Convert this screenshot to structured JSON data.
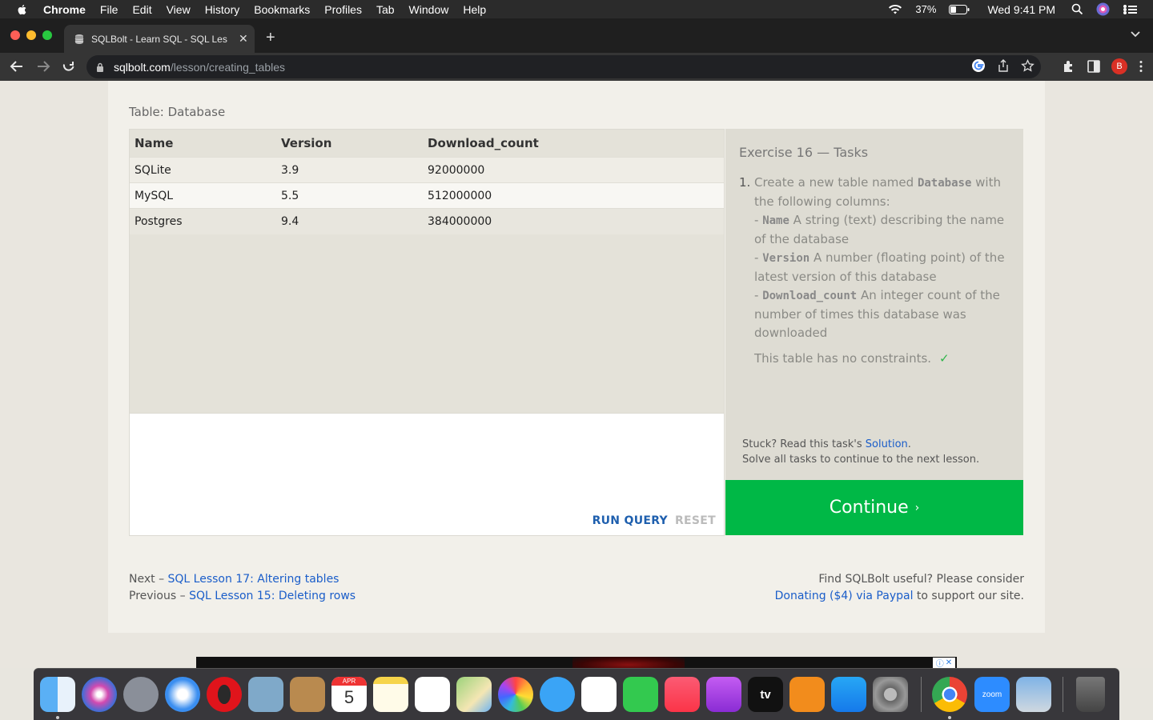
{
  "menubar": {
    "app_name": "Chrome",
    "items": [
      "File",
      "Edit",
      "View",
      "History",
      "Bookmarks",
      "Profiles",
      "Tab",
      "Window",
      "Help"
    ],
    "battery": "37%",
    "clock": "Wed 9:41 PM"
  },
  "browser": {
    "tab_title": "SQLBolt - Learn SQL - SQL Les",
    "url_host": "sqlbolt.com",
    "url_path": "/lesson/creating_tables",
    "profile_initial": "B"
  },
  "page": {
    "table_caption": "Table: Database",
    "columns": [
      "Name",
      "Version",
      "Download_count"
    ],
    "rows": [
      [
        "SQLite",
        "3.9",
        "92000000"
      ],
      [
        "MySQL",
        "5.5",
        "512000000"
      ],
      [
        "Postgres",
        "9.4",
        "384000000"
      ]
    ],
    "run_label": "RUN QUERY",
    "reset_label": "RESET",
    "tasks": {
      "heading": "Exercise 16 — Tasks",
      "number": "1.",
      "intro_a": "Create a new table named ",
      "intro_code": "Database",
      "intro_b": " with the following columns:",
      "cols": [
        {
          "code": "Name",
          "desc": " A string (text) describing the name of the database"
        },
        {
          "code": "Version",
          "desc": " A number (floating point) of the latest version of this database"
        },
        {
          "code": "Download_count",
          "desc": " An integer count of the number of times this database was downloaded"
        }
      ],
      "constraints": "This table has no constraints.",
      "check": "✓"
    },
    "stuck_a": "Stuck? Read this task's ",
    "stuck_link": "Solution",
    "stuck_b": ".",
    "solve_all": "Solve all tasks to continue to the next lesson.",
    "continue_label": "Continue",
    "continue_chevron": "›",
    "footer": {
      "next_label": "Next – ",
      "next_link": "SQL Lesson 17: Altering tables",
      "prev_label": "Previous – ",
      "prev_link": "SQL Lesson 15: Deleting rows",
      "consider": "Find SQLBolt useful? Please consider",
      "donate_link": "Donating ($4) via Paypal",
      "donate_tail": " to support our site."
    }
  },
  "colors": {
    "continue_green": "#00b846",
    "link_blue": "#1a5dc9",
    "check_green": "#2fb54a"
  },
  "dock": {
    "apps": [
      "Finder",
      "Siri",
      "Launchpad",
      "Safari",
      "Opera",
      "Preview",
      "Contacts",
      "Calendar",
      "Notes",
      "Reminders",
      "Maps",
      "Photos",
      "Messages",
      "Numbers",
      "FaceTime",
      "Music",
      "Podcasts",
      "TV",
      "Books",
      "App Store",
      "System Preferences",
      "Chrome",
      "Zoom",
      "Image Capture",
      "Trash"
    ],
    "calendar_month": "APR",
    "calendar_day": "5",
    "zoom_label": "zoom",
    "tv_label": "tv"
  }
}
